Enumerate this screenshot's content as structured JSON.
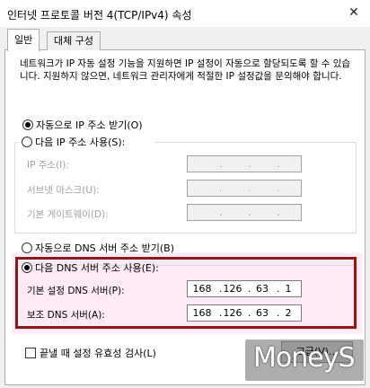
{
  "window": {
    "title": "인터넷 프로토콜 버전 4(TCP/IPv4) 속성",
    "close_glyph": "✕"
  },
  "tabs": [
    {
      "label": "일반",
      "active": true
    },
    {
      "label": "대체 구성",
      "active": false
    }
  ],
  "description": "네트워크가 IP 자동 설정 기능을 지원하면 IP 설정이 자동으로 할당되도록 할 수 있습니다. 지원하지 않으면, 네트워크 관리자에게 적절한 IP 설정값을 문의해야 합니다.",
  "ip": {
    "auto_label": "자동으로 IP 주소 받기(O)",
    "auto_selected": true,
    "manual_label": "다음 IP 주소 사용(S):",
    "manual_selected": false,
    "fields": [
      {
        "label": "IP 주소(I):",
        "value": [
          "",
          "",
          "",
          ""
        ]
      },
      {
        "label": "서브넷 마스크(U):",
        "value": [
          "",
          "",
          "",
          ""
        ]
      },
      {
        "label": "기본 게이트웨이(D):",
        "value": [
          "",
          "",
          "",
          ""
        ]
      }
    ]
  },
  "dns": {
    "auto_label": "자동으로 DNS 서버 주소 받기(B)",
    "auto_selected": false,
    "manual_label": "다음 DNS 서버 주소 사용(E):",
    "manual_selected": true,
    "fields": [
      {
        "label": "기본 설정 DNS 서버(P):",
        "value": [
          "168",
          "126",
          "63",
          "1"
        ]
      },
      {
        "label": "보조 DNS 서버(A):",
        "value": [
          "168",
          "126",
          "63",
          "2"
        ]
      }
    ]
  },
  "validate": {
    "label": "끝낼 때 설정 유효성 검사(L)",
    "checked": false
  },
  "advanced_button": {
    "label": "고급(V)..."
  },
  "watermark": {
    "text": "MoneyS"
  },
  "colors": {
    "highlight_border": "#8b1a1a"
  }
}
